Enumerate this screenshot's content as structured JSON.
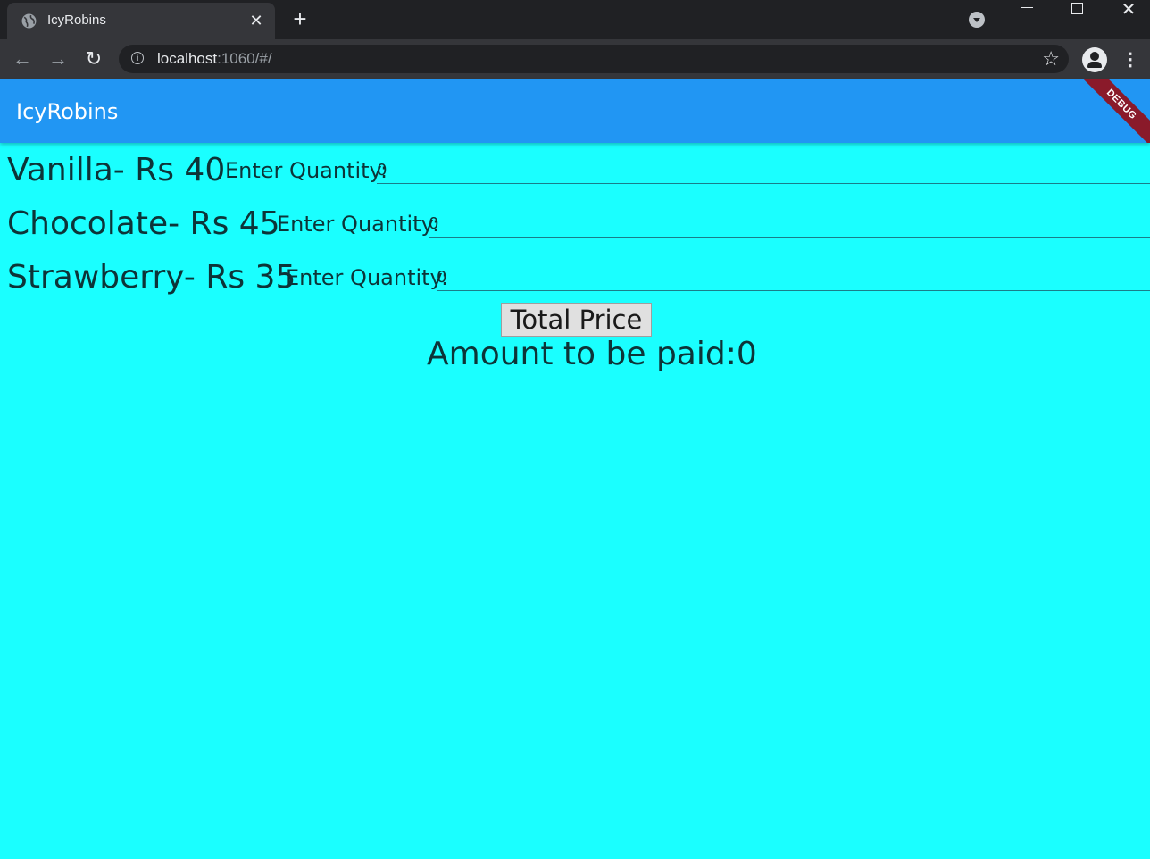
{
  "browser": {
    "tab_title": "IcyRobins",
    "tab_close": "✕",
    "new_tab": "+",
    "url_host": "localhost",
    "url_rest": ":1060/#/"
  },
  "app": {
    "title": "IcyRobins",
    "debug_banner": "DEBUG",
    "items": [
      {
        "label": "Vanilla- Rs 40",
        "qty_label": "Enter Quantity:",
        "qty_value": "0"
      },
      {
        "label": "Chocolate- Rs 45",
        "qty_label": "Enter Quantity:",
        "qty_value": "0"
      },
      {
        "label": "Strawberry- Rs 35",
        "qty_label": "Enter Quantity:",
        "qty_value": "0"
      }
    ],
    "total_button": "Total Price",
    "amount_text": "Amount to be paid:0"
  },
  "colors": {
    "appbar": "#2196f3",
    "background": "#1affff"
  }
}
